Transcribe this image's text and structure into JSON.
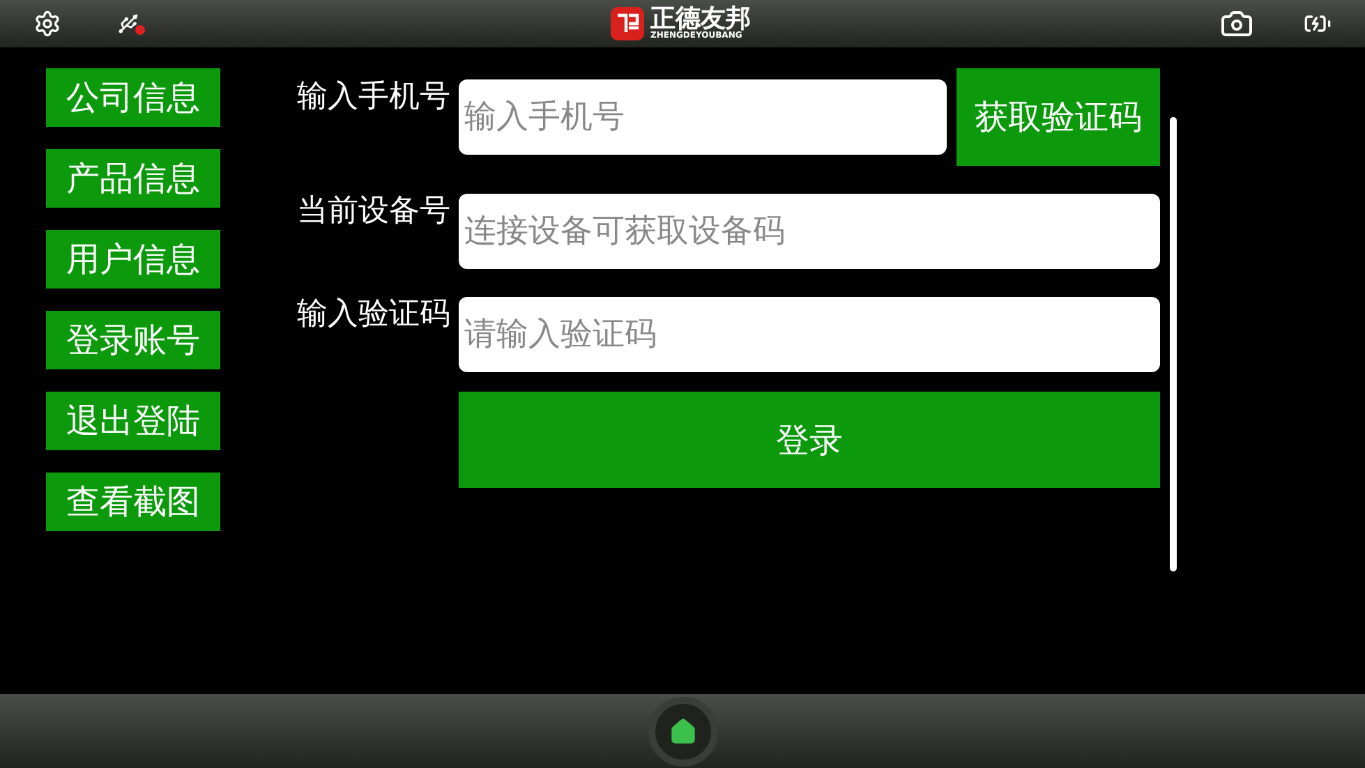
{
  "top_bar": {
    "logo_title": "正德友邦",
    "logo_subtitle": "ZHENGDEYOUBANG"
  },
  "menu": [
    {
      "label": "公司信息"
    },
    {
      "label": "产品信息"
    },
    {
      "label": "用户信息"
    },
    {
      "label": "登录账号"
    },
    {
      "label": "退出登陆"
    },
    {
      "label": "查看截图"
    }
  ],
  "form": {
    "fields": [
      {
        "label": "输入手机号",
        "placeholder": "输入手机号",
        "button": "获取验证码"
      },
      {
        "label": "当前设备号",
        "placeholder": "连接设备可获取设备码"
      },
      {
        "label": "输入验证码",
        "placeholder": "请输入验证码"
      }
    ],
    "submit": "登录"
  }
}
